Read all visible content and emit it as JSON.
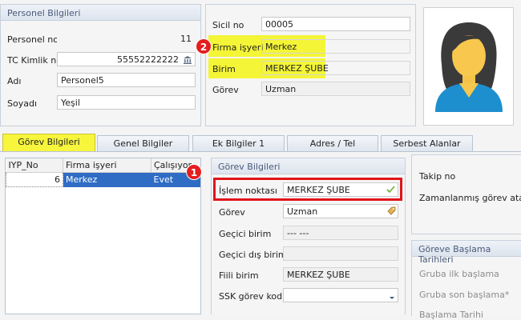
{
  "personel_panel": {
    "title": "Personel Bilgileri",
    "personel_no_label": "Personel no",
    "personel_no_value": "11",
    "tc_label": "TC Kimlik no",
    "tc_value": "55552222222",
    "adi_label": "Adı",
    "adi_value": "Personel5",
    "soyadi_label": "Soyadı",
    "soyadi_value": "Yeşil"
  },
  "sicil_panel": {
    "sicil_label": "Sicil no",
    "sicil_value": "00005",
    "firma_label": "Firma işyeri",
    "firma_value": "Merkez",
    "birim_label": "Birim",
    "birim_value": "MERKEZ ŞUBE",
    "gorev_label": "Görev",
    "gorev_value": "Uzman"
  },
  "tabs": [
    "Görev Bilgileri",
    "Genel Bilgiler",
    "Ek Bilgiler 1",
    "Adres / Tel",
    "Serbest Alanlar"
  ],
  "grid": {
    "columns": [
      "IYP_No",
      "Firma işyeri",
      "Çalışıyor"
    ],
    "rows": [
      {
        "no": "6",
        "firma": "Merkez",
        "calisiyor": "Evet"
      }
    ]
  },
  "gorev_panel": {
    "title": "Görev Bilgileri",
    "islem_label": "İşlem noktası",
    "islem_value": "MERKEZ ŞUBE",
    "gorev_label": "Görev",
    "gorev_value": "Uzman",
    "gecici_birim_label": "Geçici birim",
    "gecici_birim_value": "--- ---",
    "gecici_dis_label": "Geçici dış birim",
    "fiili_label": "Fiili birim",
    "fiili_value": "MERKEZ ŞUBE",
    "ssk_label": "SSK görev kodu"
  },
  "right_panel": {
    "takip_label": "Takip no",
    "zaman_label": "Zamanlanmış görev ataması"
  },
  "baslama_panel": {
    "title": "Göreve Başlama Tarihleri",
    "ilk_label": "Gruba ilk başlama",
    "son_label": "Gruba son başlama*",
    "cut_label": "Başlama Tarihi"
  },
  "badges": {
    "one": "1",
    "two": "2"
  },
  "colors": {
    "highlight": "#f4f536",
    "selection": "#2f6dc4",
    "badge": "#e41e1e"
  }
}
